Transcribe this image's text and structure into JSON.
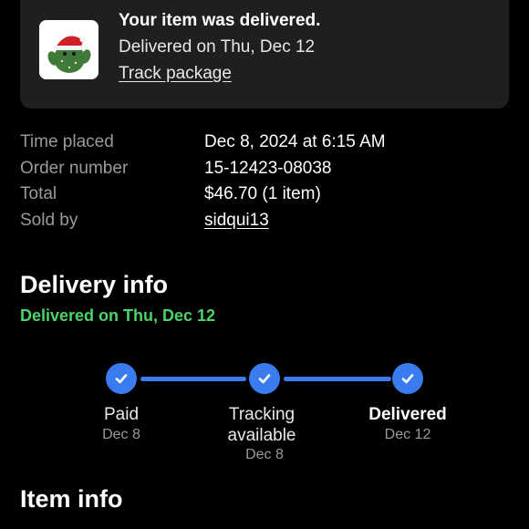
{
  "card": {
    "title": "Your item was delivered.",
    "subtitle": "Delivered on Thu, Dec 12",
    "link": "Track package",
    "thumbnail_icon": "plush-toy-icon"
  },
  "details": [
    {
      "label": "Time placed",
      "value": "Dec 8, 2024 at 6:15 AM"
    },
    {
      "label": "Order number",
      "value": "15-12423-08038"
    },
    {
      "label": "Total",
      "value": "$46.70 (1 item)"
    },
    {
      "label": "Sold by",
      "value": "sidqui13"
    }
  ],
  "delivery": {
    "heading": "Delivery info",
    "status": "Delivered on Thu, Dec 12",
    "steps": [
      {
        "label": "Paid",
        "date": "Dec 8",
        "complete": true
      },
      {
        "label": "Tracking available",
        "label_line1": "Tracking",
        "label_line2": "available",
        "date": "Dec 8",
        "complete": true
      },
      {
        "label": "Delivered",
        "date": "Dec 12",
        "complete": true
      }
    ]
  },
  "item_info": {
    "heading": "Item info"
  },
  "colors": {
    "accent_blue": "#3b7bf0",
    "status_green": "#4cd36a",
    "card_bg": "#1f1f1f",
    "muted_text": "#9a9a9a"
  }
}
